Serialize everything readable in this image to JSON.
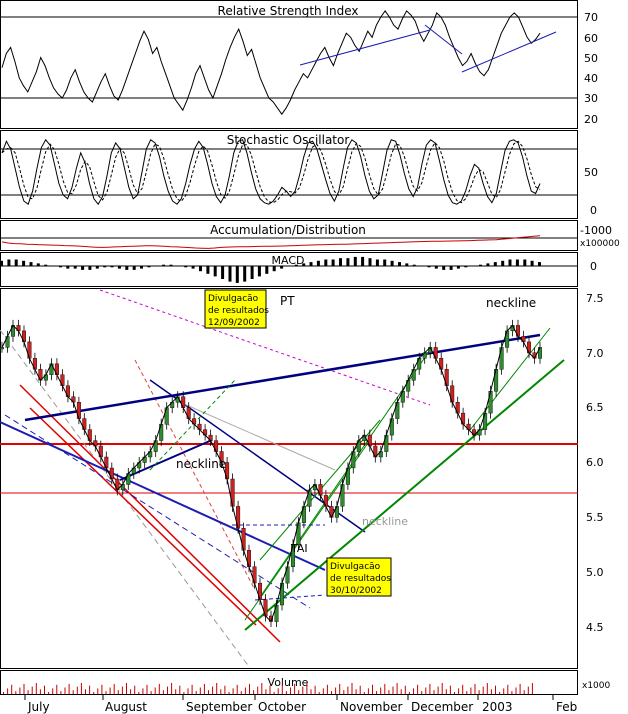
{
  "chart_data": {
    "type": "line",
    "x_months": [
      "July",
      "August",
      "September",
      "October",
      "November",
      "December",
      "2003",
      "Feb"
    ],
    "panels": [
      {
        "id": "rsi",
        "title": "Relative Strength Index",
        "yticks": [
          "70",
          "60",
          "50",
          "40",
          "30",
          "20"
        ],
        "ylim": [
          15,
          78
        ],
        "ref_lines": [
          70,
          30
        ],
        "values": [
          45,
          52,
          55,
          48,
          40,
          36,
          33,
          38,
          43,
          50,
          46,
          40,
          35,
          32,
          30,
          34,
          40,
          44,
          38,
          33,
          30,
          28,
          33,
          38,
          42,
          36,
          31,
          29,
          34,
          40,
          46,
          52,
          58,
          63,
          59,
          52,
          55,
          48,
          42,
          36,
          30,
          27,
          24,
          29,
          35,
          42,
          46,
          40,
          34,
          30,
          36,
          42,
          49,
          55,
          60,
          64,
          58,
          51,
          54,
          47,
          40,
          35,
          30,
          28,
          25,
          22,
          25,
          29,
          34,
          38,
          42,
          40,
          44,
          48,
          52,
          55,
          50,
          46,
          52,
          57,
          62,
          60,
          56,
          53,
          58,
          63,
          60,
          66,
          70,
          73,
          70,
          66,
          64,
          69,
          73,
          71,
          68,
          62,
          58,
          62,
          66,
          72,
          70,
          66,
          60,
          55,
          50,
          46,
          48,
          52,
          47,
          43,
          41,
          44,
          50,
          56,
          62,
          66,
          70,
          72,
          70,
          65,
          60,
          57,
          59,
          62
        ]
      },
      {
        "id": "stochastic",
        "title": "Stochastic Oscillator",
        "yticks": [
          "50",
          "0"
        ],
        "ylim": [
          -5,
          105
        ],
        "ref_lines": [
          80,
          20
        ],
        "values": [
          75,
          90,
          80,
          55,
          30,
          12,
          8,
          25,
          55,
          82,
          92,
          85,
          60,
          35,
          20,
          15,
          30,
          55,
          75,
          62,
          35,
          15,
          8,
          18,
          45,
          75,
          88,
          80,
          55,
          30,
          15,
          20,
          50,
          80,
          92,
          88,
          70,
          45,
          25,
          12,
          8,
          15,
          35,
          60,
          80,
          90,
          82,
          60,
          35,
          18,
          10,
          20,
          45,
          75,
          90,
          92,
          75,
          50,
          28,
          15,
          10,
          8,
          12,
          20,
          30,
          25,
          18,
          25,
          45,
          70,
          88,
          90,
          80,
          60,
          40,
          22,
          12,
          25,
          55,
          82,
          92,
          88,
          70,
          45,
          25,
          15,
          20,
          48,
          78,
          92,
          90,
          72,
          48,
          28,
          18,
          30,
          60,
          85,
          92,
          88,
          65,
          40,
          20,
          10,
          8,
          12,
          25,
          45,
          60,
          55,
          35,
          18,
          10,
          22,
          50,
          78,
          90,
          92,
          88,
          70,
          45,
          25,
          22,
          35
        ]
      },
      {
        "id": "ad",
        "title": "Accumulation/Distribution",
        "yticks": [
          "-1000"
        ],
        "unit": "x100000",
        "values": [
          -1350,
          -1450,
          -1500,
          -1520,
          -1560,
          -1580,
          -1600,
          -1620,
          -1640,
          -1650,
          -1680,
          -1700,
          -1720,
          -1760,
          -1800,
          -1830,
          -1850,
          -1830,
          -1800,
          -1780,
          -1760,
          -1740,
          -1720,
          -1700,
          -1700,
          -1720,
          -1750,
          -1780,
          -1800,
          -1830,
          -1860,
          -1900,
          -1920,
          -1940,
          -1900,
          -1850,
          -1820,
          -1800,
          -1790,
          -1780,
          -1770,
          -1760,
          -1750,
          -1740,
          -1730,
          -1720,
          -1700,
          -1680,
          -1660,
          -1640,
          -1620,
          -1600,
          -1590,
          -1580,
          -1570,
          -1560,
          -1540,
          -1520,
          -1500,
          -1480,
          -1460,
          -1440,
          -1420,
          -1400,
          -1380,
          -1360,
          -1340,
          -1320,
          -1310,
          -1300,
          -1290,
          -1280,
          -1270,
          -1260,
          -1250,
          -1230,
          -1210,
          -1190,
          -1170,
          -1150,
          -1100,
          -1050,
          -1000,
          -950,
          -900,
          -850,
          -800
        ]
      },
      {
        "id": "macd",
        "title": "MACD",
        "yticks": [
          "0"
        ],
        "values": [
          4,
          5,
          5,
          4,
          3,
          2,
          1,
          0,
          -1,
          -2,
          -2,
          -3,
          -3,
          -2,
          -1,
          -1,
          -2,
          -3,
          -3,
          -2,
          -1,
          0,
          1,
          1,
          0,
          -1,
          -2,
          -4,
          -6,
          -8,
          -10,
          -12,
          -13,
          -12,
          -10,
          -8,
          -6,
          -4,
          -2,
          0,
          1,
          2,
          3,
          4,
          5,
          5,
          6,
          6,
          7,
          7,
          6,
          5,
          5,
          4,
          3,
          2,
          1,
          0,
          -1,
          -2,
          -3,
          -3,
          -2,
          -1,
          0,
          1,
          2,
          3,
          4,
          5,
          5,
          5,
          4,
          3
        ]
      },
      {
        "id": "price",
        "yticks": [
          "7.5",
          "7.0",
          "6.5",
          "6.0",
          "5.5",
          "5.0",
          "4.5"
        ],
        "ylim": [
          4.1,
          7.6
        ],
        "values": [
          7.05,
          7.15,
          7.25,
          7.2,
          7.1,
          6.95,
          6.85,
          6.75,
          6.8,
          6.9,
          6.8,
          6.7,
          6.6,
          6.55,
          6.4,
          6.3,
          6.2,
          6.15,
          6.05,
          5.95,
          5.85,
          5.75,
          5.8,
          5.9,
          5.95,
          6.0,
          6.05,
          6.1,
          6.2,
          6.35,
          6.5,
          6.55,
          6.6,
          6.5,
          6.4,
          6.35,
          6.3,
          6.25,
          6.2,
          6.1,
          6.0,
          5.85,
          5.6,
          5.4,
          5.2,
          5.05,
          4.9,
          4.75,
          4.6,
          4.55,
          4.7,
          4.9,
          5.05,
          5.25,
          5.45,
          5.6,
          5.75,
          5.8,
          5.7,
          5.6,
          5.5,
          5.6,
          5.8,
          5.95,
          6.1,
          6.2,
          6.25,
          6.15,
          6.05,
          6.1,
          6.25,
          6.4,
          6.55,
          6.65,
          6.75,
          6.85,
          6.95,
          7.0,
          7.05,
          6.95,
          6.85,
          6.7,
          6.55,
          6.45,
          6.35,
          6.3,
          6.25,
          6.3,
          6.45,
          6.65,
          6.85,
          7.05,
          7.2,
          7.25,
          7.15,
          7.1,
          7.0,
          6.95,
          7.05
        ]
      },
      {
        "id": "volume",
        "title": "Volume",
        "unit": "x1000"
      }
    ],
    "annotations": [
      {
        "id": "pt",
        "text": "PT"
      },
      {
        "id": "tai",
        "text": "TAI"
      },
      {
        "id": "neckline-1",
        "text": "neckline"
      },
      {
        "id": "neckline-2",
        "text": "neckline"
      },
      {
        "id": "neckline-3",
        "text": "neckline"
      }
    ],
    "callouts": [
      {
        "id": "earnings-1",
        "lines": [
          "Divulgacão",
          "de resultados",
          "12/09/2002"
        ]
      },
      {
        "id": "earnings-2",
        "lines": [
          "Divulgacão",
          "de resultados",
          "30/10/2002"
        ]
      }
    ],
    "colors": {
      "price_line": "#000000",
      "up_candle": "#2e8b2e",
      "down_candle": "#cc2222",
      "trend_blue": "#1c1cb4",
      "trend_navy": "#000080",
      "trend_red": "#e00000",
      "trend_green": "#008800",
      "support_red": "#e00000",
      "callout_bg": "#ffff00",
      "ad_line": "#cc0000"
    }
  }
}
